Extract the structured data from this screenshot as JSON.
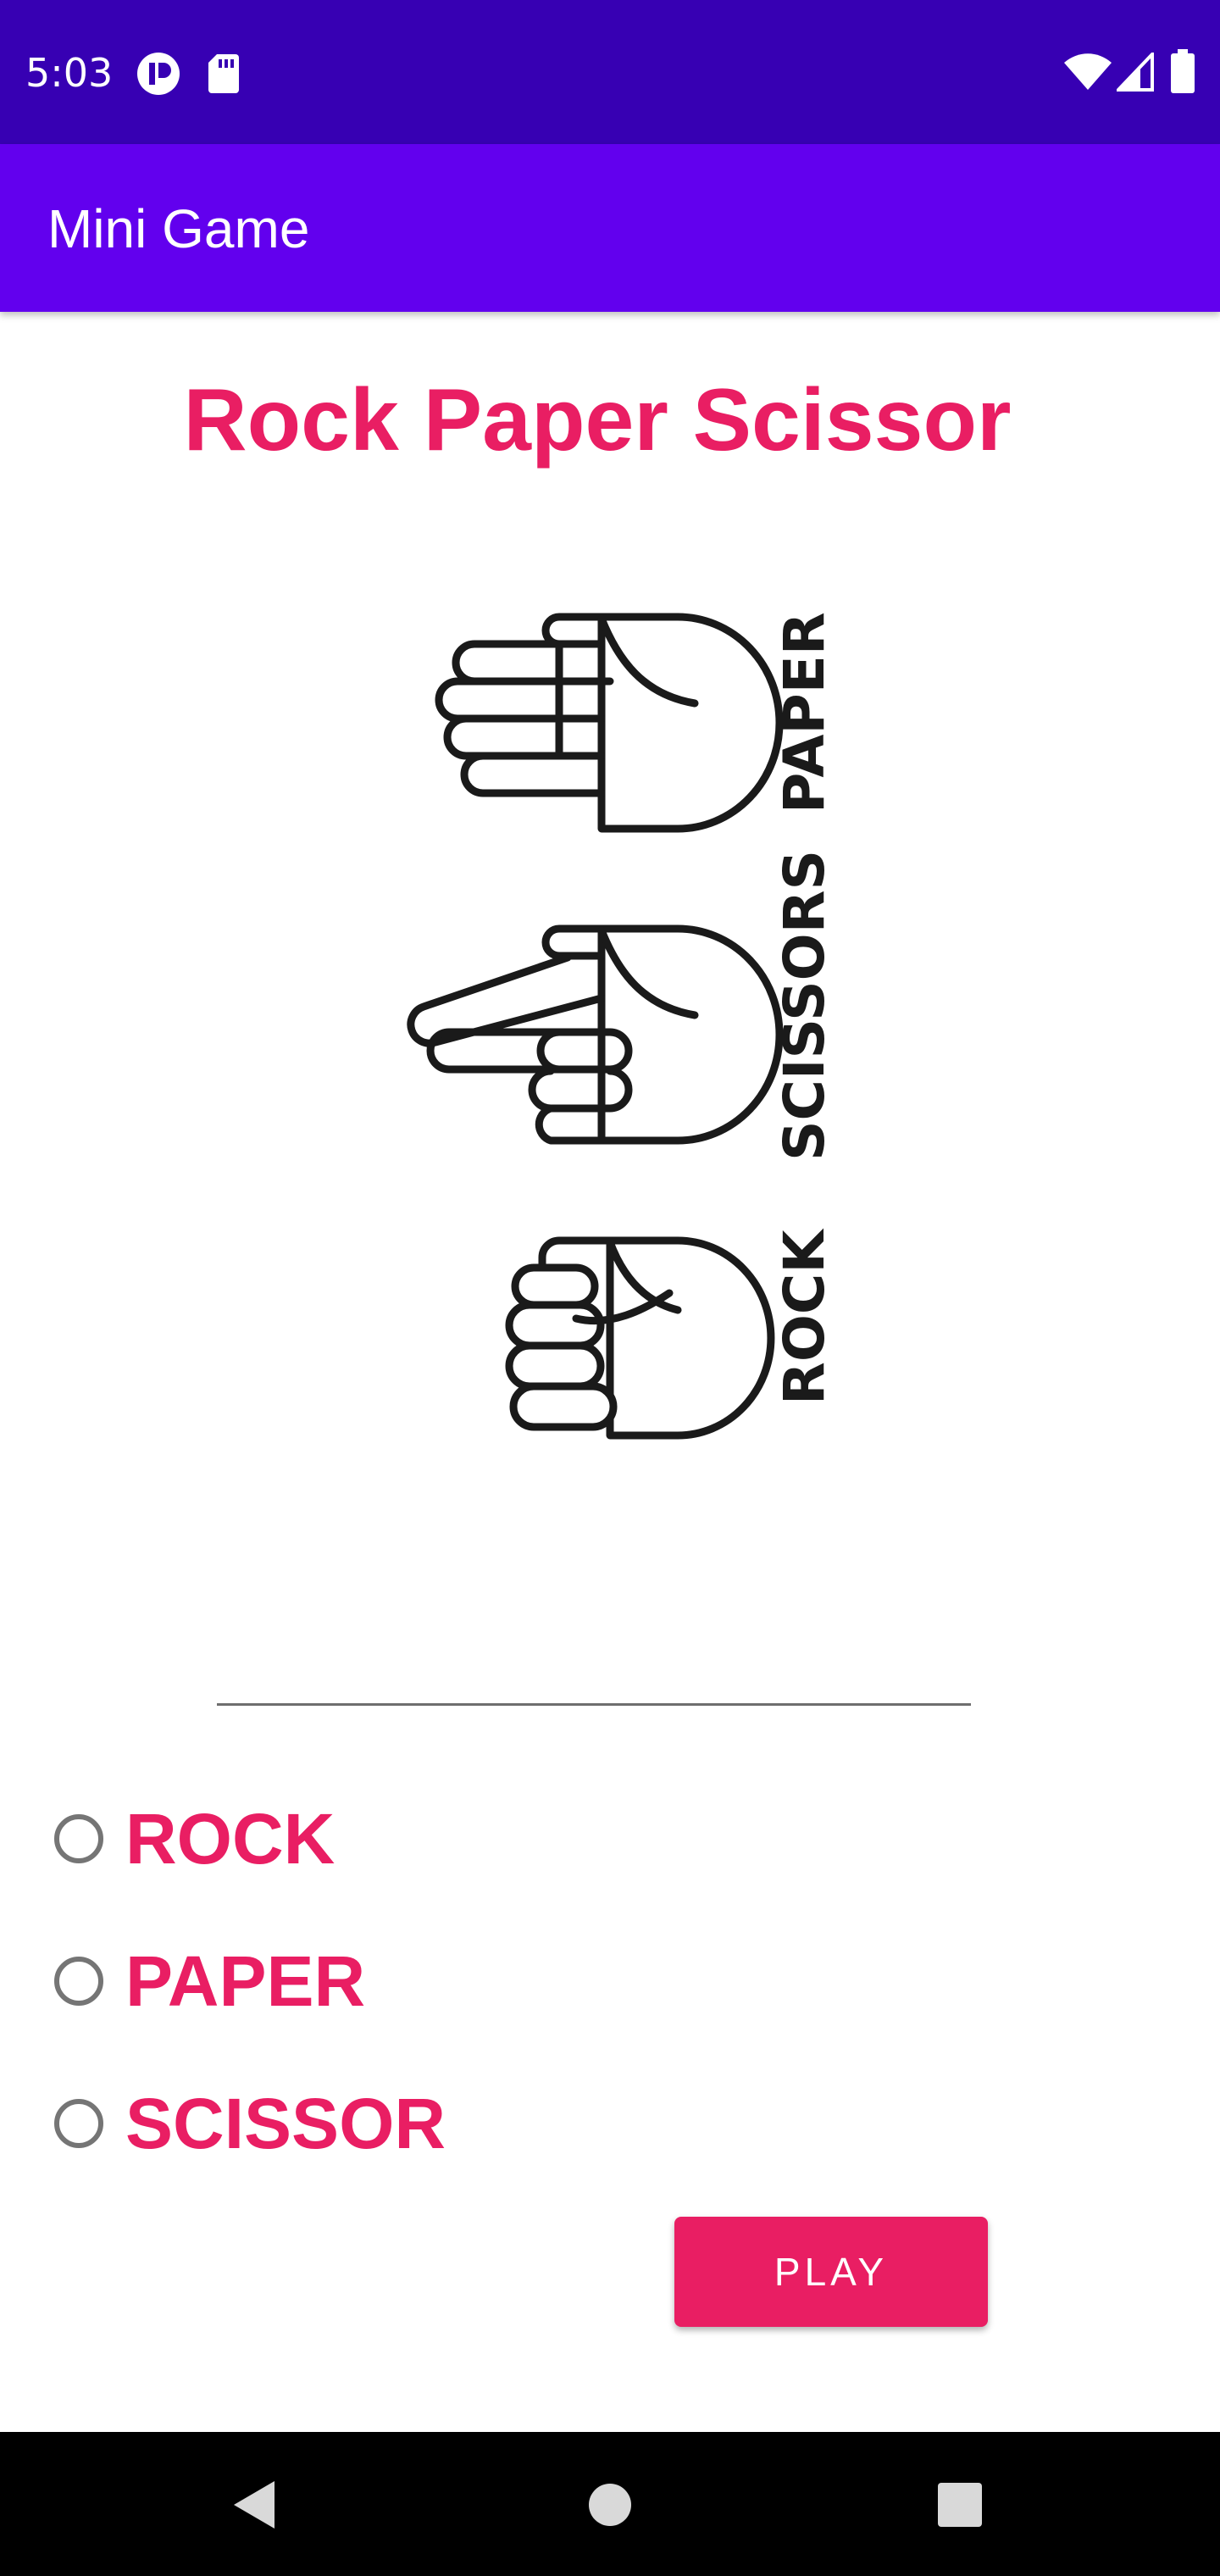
{
  "status_bar": {
    "time": "5:03",
    "icons": [
      "notification-badge-icon",
      "sd-card-icon",
      "wifi-icon",
      "cell-signal-icon",
      "battery-icon"
    ]
  },
  "app_bar": {
    "title": "Mini Game"
  },
  "heading": "Rock Paper Scissor",
  "illustration": {
    "labels": [
      "PAPER",
      "SCISSORS",
      "ROCK"
    ]
  },
  "choices": {
    "options": [
      {
        "label": "ROCK",
        "selected": false
      },
      {
        "label": "PAPER",
        "selected": false
      },
      {
        "label": "SCISSOR",
        "selected": false
      }
    ]
  },
  "play_button": {
    "label": "PLAY"
  },
  "nav_bar": {
    "buttons": [
      "back-icon",
      "home-icon",
      "recents-icon"
    ]
  },
  "colors": {
    "status_bar": "#3700B3",
    "app_bar": "#6200EE",
    "accent": "#E91E63",
    "nav_bar": "#000000"
  }
}
